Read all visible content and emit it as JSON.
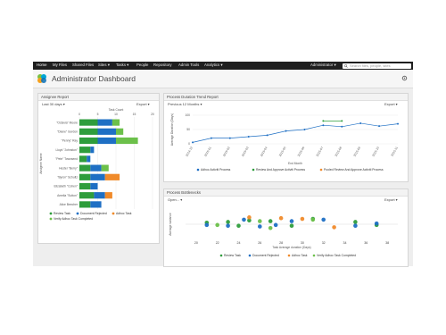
{
  "nav": {
    "items": [
      "Home",
      "My Files",
      "Shared Files",
      "Sites ▾",
      "Tasks ▾",
      "People",
      "Repository",
      "Admin Tools",
      "Analytics ▾"
    ],
    "user": "Administrator ▾",
    "search_placeholder": "Search files, people, sites"
  },
  "page": {
    "title": "Administrator Dashboard"
  },
  "assignee": {
    "header": "Assignee Report",
    "range": "Last 30 days",
    "export": "Export",
    "axis_title": "Task Count",
    "ylabel": "Assignee Name",
    "ticks": [
      "0",
      "5",
      "10",
      "15",
      "20"
    ],
    "names": [
      "\"Octavia\" Moore",
      "\"Diane\" Gordon",
      "\"Penny\" Ray",
      "Lloyd \"Johnston\"",
      "\"Pete\" Townsend",
      "Hester \"Berry\"",
      "\"Byron\" Schultz",
      "Elizabeth \"Cohen\"",
      "Amelia \"Sutton\"",
      "Alice Beecher"
    ],
    "legend": [
      "Review Task",
      "Document Rejected",
      "Adhoc Task",
      "Verify Adhoc Task Completed"
    ]
  },
  "trend": {
    "header": "Process Duration Trend Report",
    "range": "Previous 12 Months",
    "export": "Export",
    "ylabel": "Average Duration (Days)",
    "xlabel": "End Month",
    "yticks": [
      "100",
      "50",
      "0"
    ],
    "months": [
      "2014-12",
      "2015-01",
      "2015-02",
      "2015-03",
      "2015-04",
      "2015-05",
      "2015-06",
      "2015-07",
      "2015-08",
      "2015-09",
      "2015-10",
      "2015-11"
    ],
    "legend": [
      "Adhoc Activiti Process",
      "Review And Approve Activiti Process",
      "Pooled Review And Approve Activiti Process"
    ]
  },
  "bottlenecks": {
    "header": "Process Bottlenecks",
    "range": "Open",
    "export": "Export",
    "ylabel": "Average variance",
    "xlabel": "Task Average duration (Days)",
    "xticks": [
      "20",
      "22",
      "24",
      "26",
      "28",
      "30",
      "32",
      "34",
      "36",
      "38"
    ],
    "legend": [
      "Review Task",
      "Document Rejected",
      "Adhoc Task",
      "Verify Adhoc Task Completed"
    ]
  },
  "colors": {
    "review": "#2e9d3c",
    "rejected": "#1e6fc4",
    "adhoc": "#f08a2a",
    "verify": "#6cc04a"
  },
  "chart_data": [
    {
      "type": "bar",
      "title": "Assignee Report",
      "xlabel": "Task Count",
      "ylabel": "Assignee Name",
      "xlim": [
        0,
        20
      ],
      "categories": [
        "\"Octavia\" Moore",
        "\"Diane\" Gordon",
        "\"Penny\" Ray",
        "Lloyd \"Johnston\"",
        "\"Pete\" Townsend",
        "Hester \"Berry\"",
        "\"Byron\" Schultz",
        "Elizabeth \"Cohen\"",
        "Amelia \"Sutton\"",
        "Alice Beecher"
      ],
      "series": [
        {
          "name": "Review Task",
          "values": [
            5,
            5,
            5,
            3,
            2,
            3,
            3,
            3,
            4,
            3
          ]
        },
        {
          "name": "Document Rejected",
          "values": [
            4,
            5,
            5,
            1,
            1,
            3,
            4,
            2,
            3,
            3
          ]
        },
        {
          "name": "Adhoc Task",
          "values": [
            0,
            0,
            0,
            0,
            0,
            0,
            4,
            0,
            2,
            0
          ]
        },
        {
          "name": "Verify Adhoc Task Completed",
          "values": [
            2,
            2,
            6,
            0,
            0,
            2,
            0,
            0,
            0,
            0
          ]
        }
      ]
    },
    {
      "type": "line",
      "title": "Process Duration Trend Report",
      "xlabel": "End Month",
      "ylabel": "Average Duration (Days)",
      "ylim": [
        0,
        100
      ],
      "x": [
        "2014-12",
        "2015-01",
        "2015-02",
        "2015-03",
        "2015-04",
        "2015-05",
        "2015-06",
        "2015-07",
        "2015-08",
        "2015-09",
        "2015-10",
        "2015-11"
      ],
      "series": [
        {
          "name": "Adhoc Activiti Process",
          "values": [
            5,
            20,
            20,
            25,
            30,
            45,
            50,
            65,
            60,
            72,
            62,
            70
          ]
        },
        {
          "name": "Review And Approve Activiti Process",
          "values": [
            null,
            null,
            null,
            null,
            null,
            null,
            null,
            80,
            80,
            null,
            null,
            null
          ]
        },
        {
          "name": "Pooled Review And Approve Activiti Process",
          "values": [
            null,
            null,
            null,
            null,
            null,
            null,
            null,
            null,
            null,
            null,
            null,
            null
          ]
        }
      ]
    },
    {
      "type": "scatter",
      "title": "Process Bottlenecks",
      "xlabel": "Task Average duration (Days)",
      "ylabel": "Average variance",
      "xlim": [
        19,
        39
      ],
      "ylim": [
        -1,
        1
      ],
      "series": [
        {
          "name": "Review Task",
          "points": [
            [
              21,
              0.1
            ],
            [
              23,
              0.15
            ],
            [
              24,
              -0.1
            ],
            [
              25,
              0.25
            ],
            [
              27,
              0.2
            ],
            [
              29,
              -0.1
            ],
            [
              31,
              0.35
            ],
            [
              35,
              0.15
            ],
            [
              37,
              -0.05
            ]
          ]
        },
        {
          "name": "Document Rejected",
          "points": [
            [
              21,
              -0.05
            ],
            [
              23,
              -0.1
            ],
            [
              24.5,
              0.3
            ],
            [
              26,
              -0.15
            ],
            [
              27.5,
              -0.05
            ],
            [
              29,
              0.2
            ],
            [
              32,
              0.3
            ],
            [
              35,
              -0.1
            ],
            [
              37,
              0.05
            ]
          ]
        },
        {
          "name": "Adhoc Task",
          "points": [
            [
              25,
              0.45
            ],
            [
              28,
              0.4
            ],
            [
              30,
              0.35
            ],
            [
              33,
              -0.2
            ]
          ]
        },
        {
          "name": "Verify Adhoc Task Completed",
          "points": [
            [
              22,
              -0.05
            ],
            [
              26,
              0.2
            ],
            [
              27,
              -0.25
            ],
            [
              31,
              0.3
            ]
          ]
        }
      ]
    }
  ]
}
